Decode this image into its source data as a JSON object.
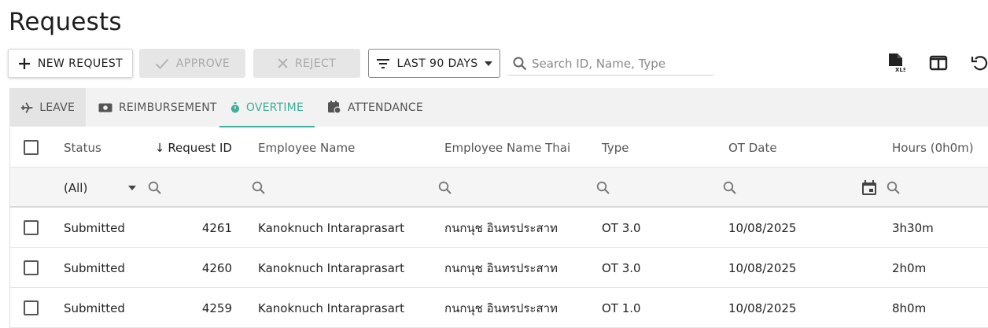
{
  "page": {
    "title": "Requests"
  },
  "toolbar": {
    "new_request_label": "NEW REQUEST",
    "approve_label": "APPROVE",
    "reject_label": "REJECT",
    "date_filter_label": "LAST 90 DAYS",
    "search_placeholder": "Search ID, Name, Type",
    "icons": [
      "export-xls-icon",
      "columns-icon",
      "refresh-icon"
    ]
  },
  "tabs": [
    {
      "label": "LEAVE",
      "icon": "airplane-icon"
    },
    {
      "label": "REIMBURSEMENT",
      "icon": "cash-icon"
    },
    {
      "label": "OVERTIME",
      "icon": "stopwatch-icon",
      "active": true
    },
    {
      "label": "ATTENDANCE",
      "icon": "calendar-clock-icon"
    }
  ],
  "grid": {
    "columns": [
      "Status",
      "Request ID",
      "Employee Name",
      "Employee Name Thai",
      "Type",
      "OT Date",
      "Hours (0h0m)"
    ],
    "sort_indicator": "↓",
    "status_filter_value": "(All)",
    "rows": [
      {
        "status": "Submitted",
        "id": "4261",
        "name": "Kanoknuch Intaraprasart",
        "name_thai": "กนกนุช อินทรประสาท",
        "type": "OT 3.0",
        "date": "10/08/2025",
        "hours": "3h30m"
      },
      {
        "status": "Submitted",
        "id": "4260",
        "name": "Kanoknuch Intaraprasart",
        "name_thai": "กนกนุช อินทรประสาท",
        "type": "OT 3.0",
        "date": "10/08/2025",
        "hours": "2h0m"
      },
      {
        "status": "Submitted",
        "id": "4259",
        "name": "Kanoknuch Intaraprasart",
        "name_thai": "กนกนุช อินทรประสาท",
        "type": "OT 1.0",
        "date": "10/08/2025",
        "hours": "8h0m"
      }
    ]
  },
  "colors": {
    "accent": "#3fae9a",
    "disabled_bg": "#e6e6e6",
    "disabled_text": "#a9a9a9"
  }
}
